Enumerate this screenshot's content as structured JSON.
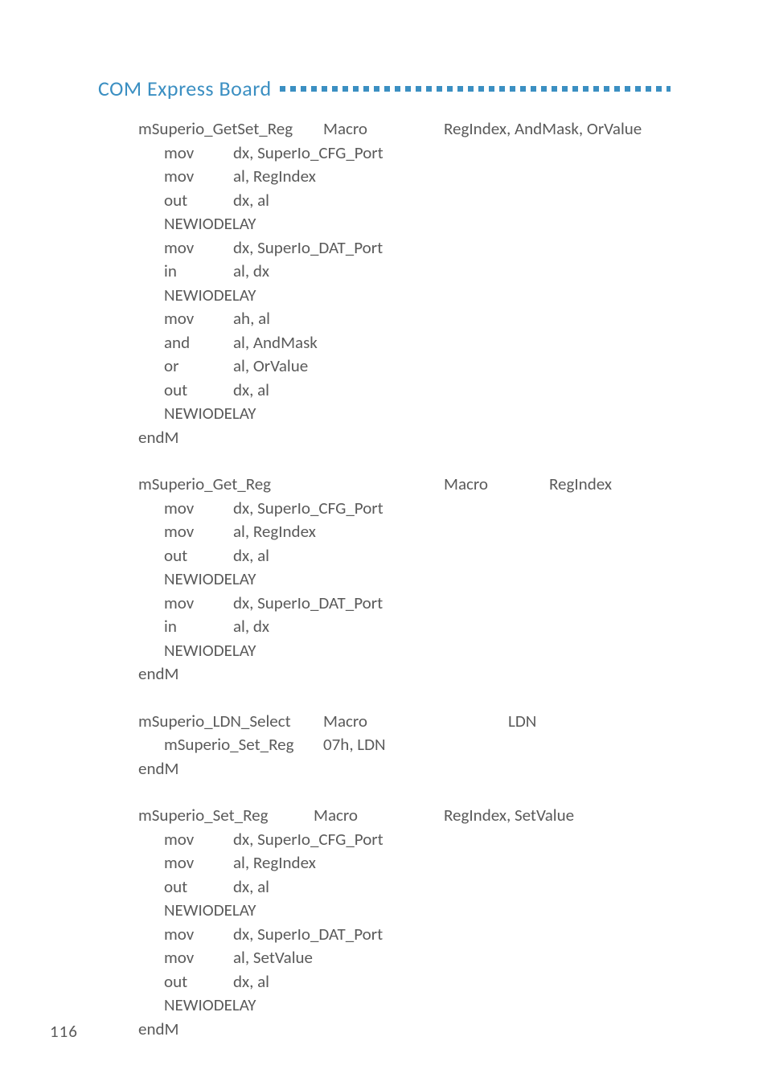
{
  "header": {
    "title": "COM Express Board"
  },
  "code": {
    "block1": "mSuperio_GetSet_Reg\tMacro\tRegIndex, AndMask, OrValue\n\tmov\tdx, SuperIo_CFG_Port\n\tmov\tal, RegIndex\n\tout\tdx, al\n\tNEWIODELAY\n\tmov\tdx, SuperIo_DAT_Port\n\tin\tal, dx\n\tNEWIODELAY\n\tmov\tah, al\n\tand\tal, AndMask\n\tor\tal, OrValue\n\tout\tdx, al\n\tNEWIODELAY\nendM",
    "block2": "mSuperio_Get_Reg\t\tMacro\tRegIndex\n\tmov\tdx, SuperIo_CFG_Port\n\tmov\tal, RegIndex\n\tout\tdx, al\n\tNEWIODELAY\n\tmov\tdx, SuperIo_DAT_Port\n\tin\tal, dx\n\tNEWIODELAY\nendM",
    "block3": "mSuperio_LDN_Select\tMacro\t\tLDN\n\tmSuperio_Set_Reg\t07h, LDN\nendM",
    "block4": "mSuperio_Set_Reg\tMacro\tRegIndex, SetValue\n\tmov\tdx, SuperIo_CFG_Port\n\tmov\tal, RegIndex\n\tout\tdx, al\n\tNEWIODELAY\n\tmov\tdx, SuperIo_DAT_Port\n\tmov\tal, SetValue\n\tout\tdx, al\n\tNEWIODELAY\nendM"
  },
  "page": {
    "number": "116"
  }
}
